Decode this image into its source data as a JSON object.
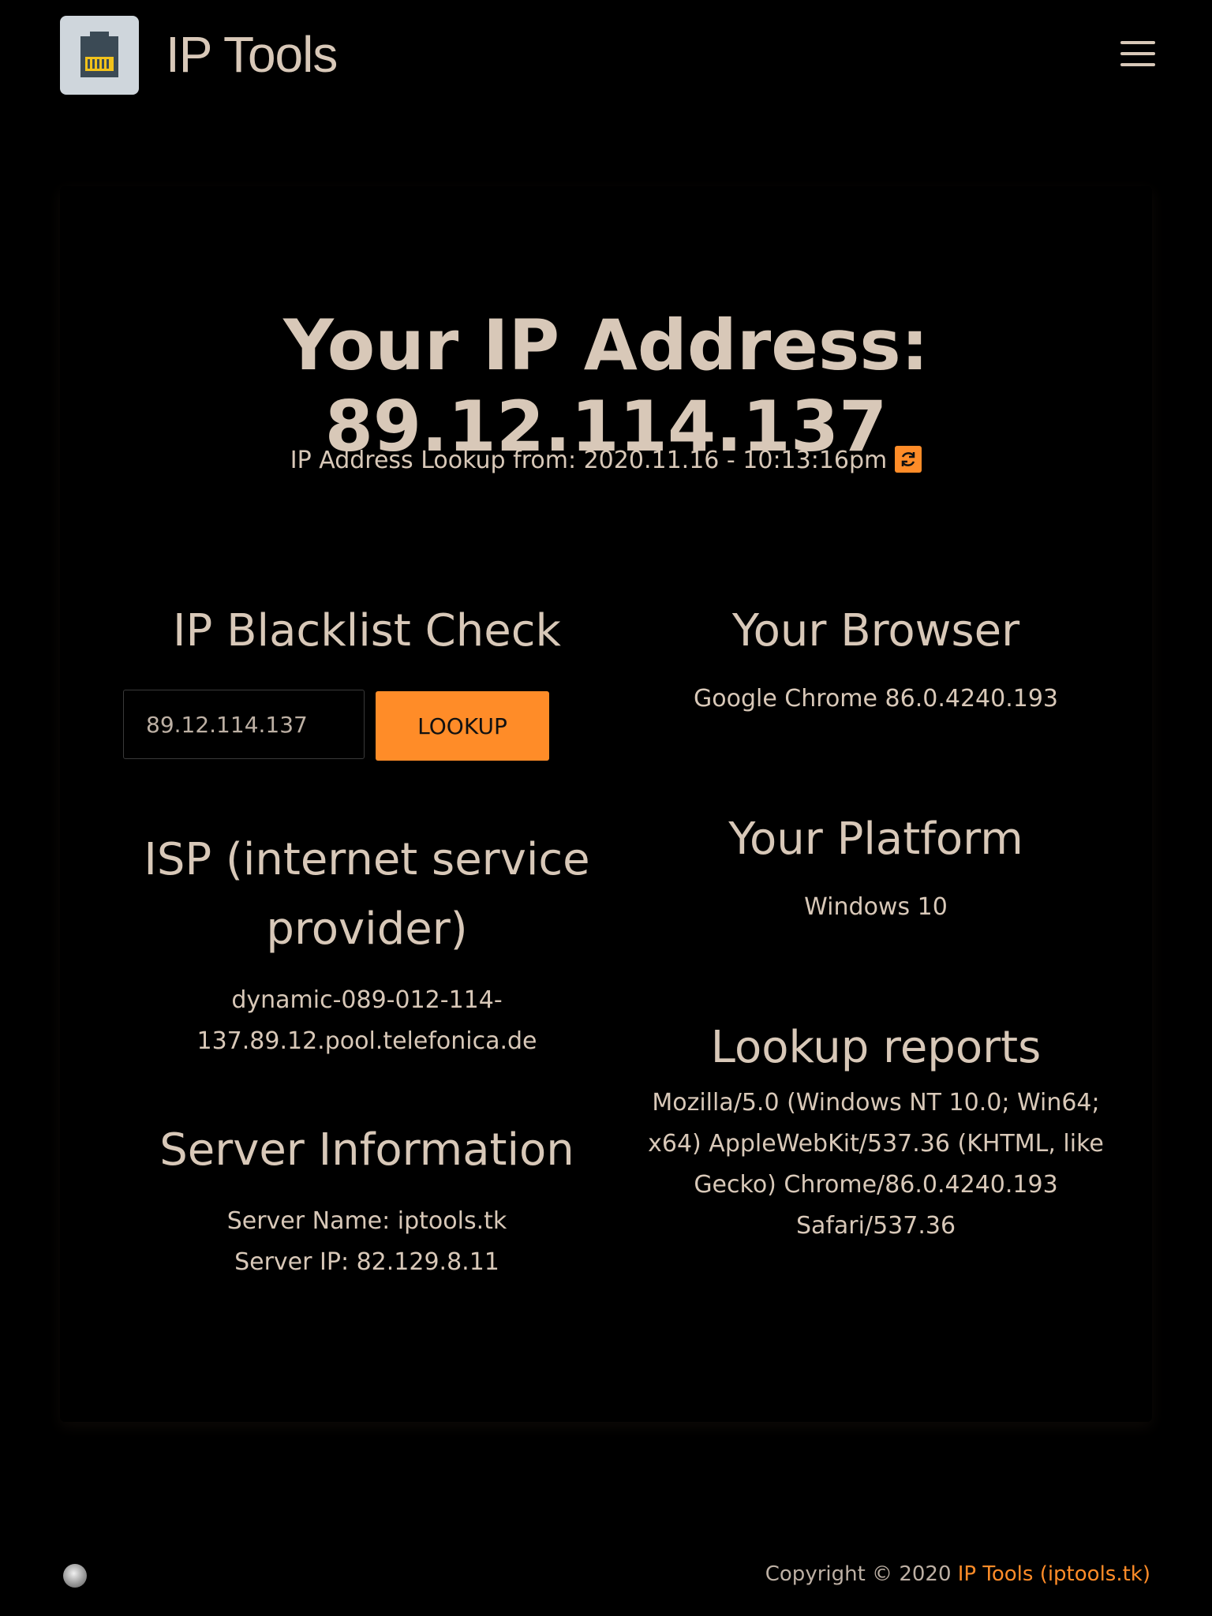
{
  "header": {
    "brand": "IP Tools",
    "menu_icon": "hamburger-menu-icon",
    "logo_icon": "ethernet-port-icon"
  },
  "hero": {
    "title": "Your IP Address: 89.12.114.137",
    "lookup_text": "IP Address Lookup from: 2020.11.16 - 10:13:16pm",
    "refresh_icon": "refresh-icon"
  },
  "blacklist": {
    "heading": "IP Blacklist Check",
    "input_value": "89.12.114.137",
    "button_label": "LOOKUP"
  },
  "isp": {
    "heading_line1": "ISP (internet service",
    "heading_line2": "provider)",
    "value_line1": "dynamic-089-012-114-",
    "value_line2": "137.89.12.pool.telefonica.de"
  },
  "server": {
    "heading": "Server Information",
    "name_line": "Server Name: iptools.tk",
    "ip_line": "Server IP: 82.129.8.11"
  },
  "browser": {
    "heading": "Your Browser",
    "value": "Google Chrome 86.0.4240.193"
  },
  "platform": {
    "heading": "Your Platform",
    "value": "Windows 10"
  },
  "reports": {
    "heading": "Lookup reports",
    "line1": "Mozilla/5.0 (Windows NT 10.0; Win64;",
    "line2": "x64) AppleWebKit/537.36 (KHTML, like",
    "line3": "Gecko) Chrome/86.0.4240.193",
    "line4": "Safari/537.36"
  },
  "footer": {
    "copyright": "Copyright © 2020",
    "link_text": "IP Tools (iptools.tk)",
    "badge_icon": "globe-badge-icon"
  },
  "colors": {
    "accent": "#ff8c28",
    "text": "#d8c8b8",
    "background": "#000000"
  }
}
